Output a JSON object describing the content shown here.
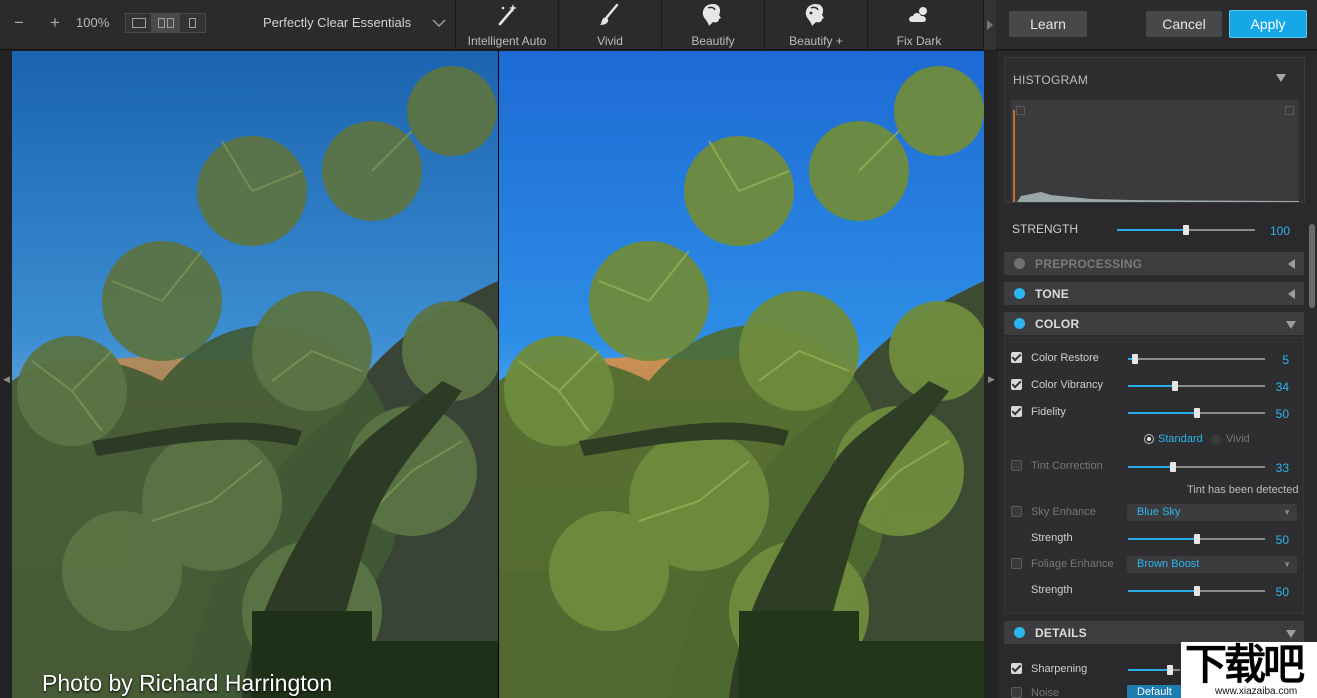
{
  "toolbar": {
    "zoom_out_glyph": "−",
    "zoom_in_glyph": "+",
    "zoom_level": "100%",
    "preset_name": "Perfectly Clear Essentials",
    "presets": [
      {
        "label": "Intelligent Auto",
        "icon": "magic-wand-icon"
      },
      {
        "label": "Vivid",
        "icon": "brush-icon"
      },
      {
        "label": "Beautify",
        "icon": "face-profile-icon"
      },
      {
        "label": "Beautify +",
        "icon": "face-profile-plus-icon"
      },
      {
        "label": "Fix Dark",
        "icon": "cloud-sun-icon"
      }
    ],
    "learn_label": "Learn",
    "cancel_label": "Cancel",
    "apply_label": "Apply"
  },
  "colors": {
    "accent": "#2bb6f0",
    "apply": "#16a7e6",
    "panel_bg": "#2a2a2c",
    "toolbar_bg": "#2b2b2d"
  },
  "image": {
    "credit": "Photo by Richard Harrington"
  },
  "panel": {
    "histogram_title": "HISTOGRAM",
    "strength": {
      "label": "STRENGTH",
      "value": "100",
      "level": 0.5
    },
    "sections": {
      "preprocessing": "PREPROCESSING",
      "tone": "TONE",
      "color": "COLOR",
      "details": "DETAILS"
    },
    "color": {
      "color_restore": {
        "label": "Color Restore",
        "value": "5",
        "level": 0.05,
        "checked": true
      },
      "color_vibrancy": {
        "label": "Color Vibrancy",
        "value": "34",
        "level": 0.34,
        "checked": true
      },
      "fidelity": {
        "label": "Fidelity",
        "value": "50",
        "level": 0.5,
        "checked": true
      },
      "fidelity_mode": {
        "standard": "Standard",
        "vivid": "Vivid",
        "selected": "Standard"
      },
      "tint_correction": {
        "label": "Tint Correction",
        "value": "33",
        "level": 0.33,
        "checked": false
      },
      "tint_note": "Tint has been detected",
      "sky_enhance": {
        "label": "Sky Enhance",
        "option": "Blue Sky",
        "checked": false
      },
      "sky_strength": {
        "label": "Strength",
        "value": "50",
        "level": 0.5
      },
      "foliage_enhance": {
        "label": "Foliage Enhance",
        "option": "Brown Boost",
        "checked": false
      },
      "foliage_strength": {
        "label": "Strength",
        "value": "50",
        "level": 0.5
      }
    },
    "details": {
      "sharpening": {
        "label": "Sharpening",
        "checked": true
      },
      "noise": {
        "label": "Noise",
        "option": "Default",
        "checked": false
      }
    }
  },
  "watermark": {
    "chars": "下载吧",
    "site": "www.xiazaiba.com"
  }
}
